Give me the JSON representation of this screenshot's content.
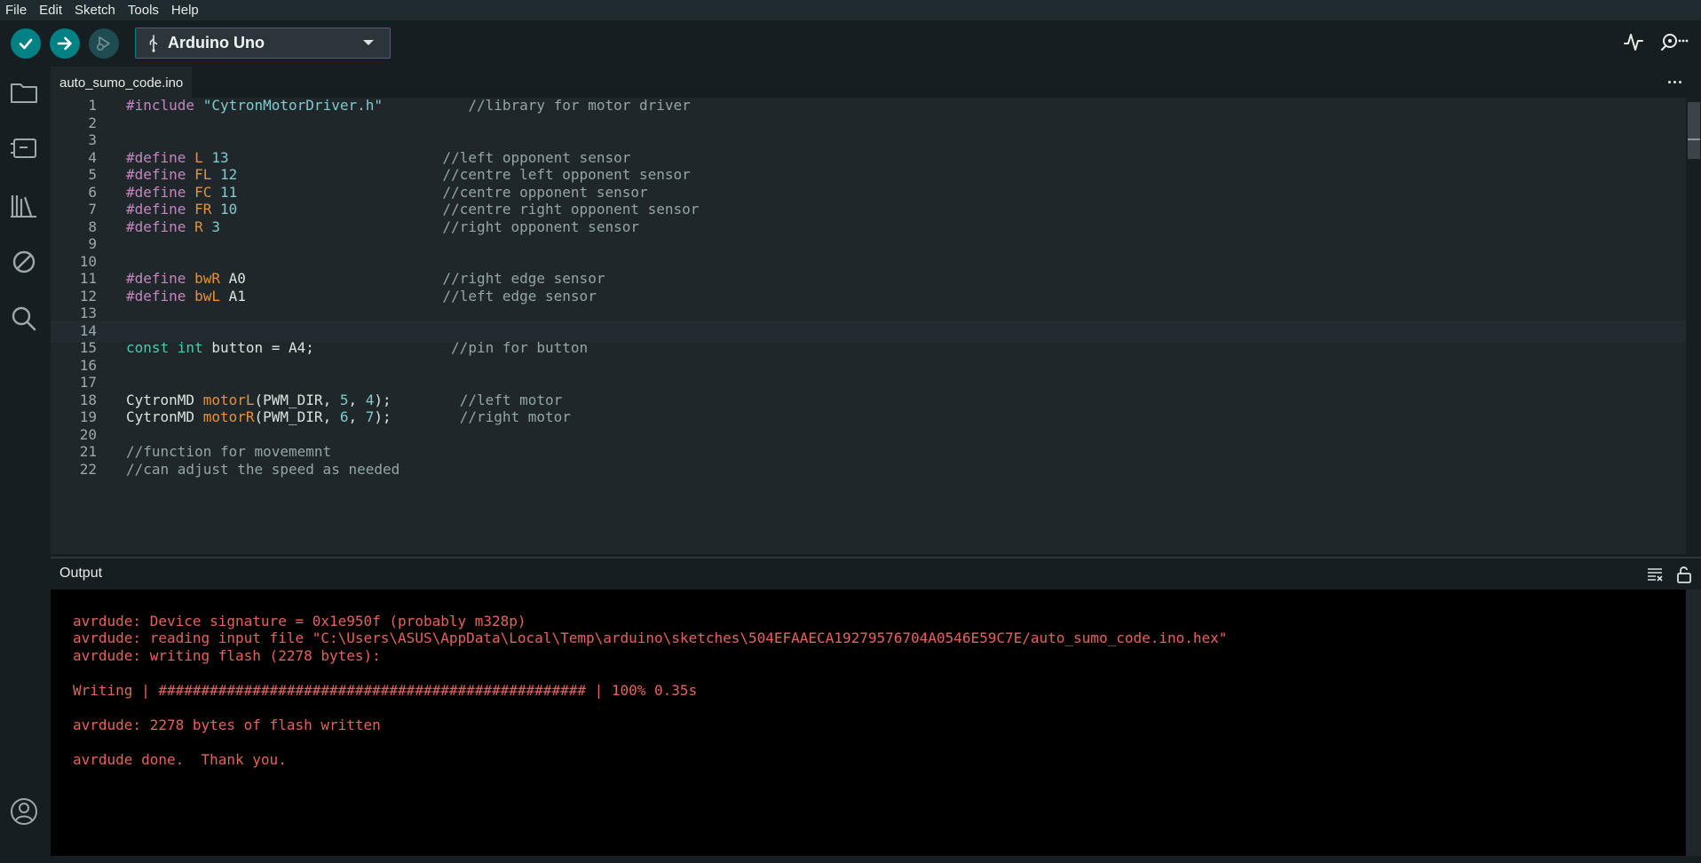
{
  "menu": [
    "File",
    "Edit",
    "Sketch",
    "Tools",
    "Help"
  ],
  "toolbar": {
    "board_name": "Arduino Uno"
  },
  "tabs": [
    {
      "label": "auto_sumo_code.ino"
    }
  ],
  "editor": {
    "lines": [
      {
        "n": "1",
        "tokens": [
          {
            "t": "#include ",
            "c": "k-dir"
          },
          {
            "t": "\"CytronMotorDriver.h\"",
            "c": "k-str"
          },
          {
            "t": "          //library for motor driver",
            "c": "k-com"
          }
        ]
      },
      {
        "n": "2",
        "tokens": []
      },
      {
        "n": "3",
        "tokens": []
      },
      {
        "n": "4",
        "tokens": [
          {
            "t": "#define ",
            "c": "k-dir"
          },
          {
            "t": "L",
            "c": "k-macro"
          },
          {
            "t": " 13",
            "c": "k-num"
          },
          {
            "t": "                         //left opponent sensor",
            "c": "k-com"
          }
        ]
      },
      {
        "n": "5",
        "tokens": [
          {
            "t": "#define ",
            "c": "k-dir"
          },
          {
            "t": "FL",
            "c": "k-macro"
          },
          {
            "t": " 12",
            "c": "k-num"
          },
          {
            "t": "                        //centre left opponent sensor",
            "c": "k-com"
          }
        ]
      },
      {
        "n": "6",
        "tokens": [
          {
            "t": "#define ",
            "c": "k-dir"
          },
          {
            "t": "FC",
            "c": "k-macro"
          },
          {
            "t": " 11",
            "c": "k-num"
          },
          {
            "t": "                        //centre opponent sensor",
            "c": "k-com"
          }
        ]
      },
      {
        "n": "7",
        "tokens": [
          {
            "t": "#define ",
            "c": "k-dir"
          },
          {
            "t": "FR",
            "c": "k-macro"
          },
          {
            "t": " 10",
            "c": "k-num"
          },
          {
            "t": "                        //centre right opponent sensor",
            "c": "k-com"
          }
        ]
      },
      {
        "n": "8",
        "tokens": [
          {
            "t": "#define ",
            "c": "k-dir"
          },
          {
            "t": "R",
            "c": "k-macro"
          },
          {
            "t": " 3",
            "c": "k-num"
          },
          {
            "t": "                          //right opponent sensor",
            "c": "k-com"
          }
        ]
      },
      {
        "n": "9",
        "tokens": []
      },
      {
        "n": "10",
        "tokens": []
      },
      {
        "n": "11",
        "tokens": [
          {
            "t": "#define ",
            "c": "k-dir"
          },
          {
            "t": "bwR",
            "c": "k-macro"
          },
          {
            "t": " A0",
            "c": "k-plain"
          },
          {
            "t": "                       //right edge sensor",
            "c": "k-com"
          }
        ]
      },
      {
        "n": "12",
        "tokens": [
          {
            "t": "#define ",
            "c": "k-dir"
          },
          {
            "t": "bwL",
            "c": "k-macro"
          },
          {
            "t": " A1",
            "c": "k-plain"
          },
          {
            "t": "                       //left edge sensor",
            "c": "k-com"
          }
        ]
      },
      {
        "n": "13",
        "tokens": []
      },
      {
        "n": "14",
        "tokens": [],
        "current": true
      },
      {
        "n": "15",
        "tokens": [
          {
            "t": "const ",
            "c": "k-type"
          },
          {
            "t": "int ",
            "c": "k-type"
          },
          {
            "t": "button = A4;",
            "c": "k-plain"
          },
          {
            "t": "                //pin for button",
            "c": "k-com"
          }
        ]
      },
      {
        "n": "16",
        "tokens": []
      },
      {
        "n": "17",
        "tokens": []
      },
      {
        "n": "18",
        "tokens": [
          {
            "t": "CytronMD ",
            "c": "k-plain"
          },
          {
            "t": "motorL",
            "c": "k-fn"
          },
          {
            "t": "(PWM_DIR, ",
            "c": "k-plain"
          },
          {
            "t": "5",
            "c": "k-num"
          },
          {
            "t": ", ",
            "c": "k-plain"
          },
          {
            "t": "4",
            "c": "k-num"
          },
          {
            "t": ");",
            "c": "k-plain"
          },
          {
            "t": "        //left motor",
            "c": "k-com"
          }
        ]
      },
      {
        "n": "19",
        "tokens": [
          {
            "t": "CytronMD ",
            "c": "k-plain"
          },
          {
            "t": "motorR",
            "c": "k-fn"
          },
          {
            "t": "(PWM_DIR, ",
            "c": "k-plain"
          },
          {
            "t": "6",
            "c": "k-num"
          },
          {
            "t": ", ",
            "c": "k-plain"
          },
          {
            "t": "7",
            "c": "k-num"
          },
          {
            "t": ");",
            "c": "k-plain"
          },
          {
            "t": "        //right motor",
            "c": "k-com"
          }
        ]
      },
      {
        "n": "20",
        "tokens": []
      },
      {
        "n": "21",
        "tokens": [
          {
            "t": "//function for movememnt",
            "c": "k-com"
          }
        ]
      },
      {
        "n": "22",
        "tokens": [
          {
            "t": "//can adjust the speed as needed",
            "c": "k-com"
          }
        ]
      }
    ]
  },
  "output": {
    "title": "Output",
    "lines": [
      "",
      "avrdude: Device signature = 0x1e950f (probably m328p)",
      "avrdude: reading input file \"C:\\Users\\ASUS\\AppData\\Local\\Temp\\arduino\\sketches\\504EFAAECA19279576704A0546E59C7E/auto_sumo_code.ino.hex\"",
      "avrdude: writing flash (2278 bytes):",
      "",
      "Writing | ################################################## | 100% 0.35s",
      "",
      "avrdude: 2278 bytes of flash written",
      "",
      "avrdude done.  Thank you."
    ]
  },
  "colors": {
    "accent": "#008184",
    "output_text": "#e4635c",
    "editor_bg": "#1f272a"
  },
  "icons": {
    "verify": "check-icon",
    "upload": "arrow-right-icon",
    "debug": "debug-icon",
    "usb": "usb-icon",
    "serial_plotter": "serial-plotter-icon",
    "serial_monitor": "serial-monitor-icon",
    "sidebar": [
      "folder-icon",
      "boards-manager-icon",
      "library-icon",
      "debug-disabled-icon",
      "search-icon",
      "account-icon"
    ]
  }
}
